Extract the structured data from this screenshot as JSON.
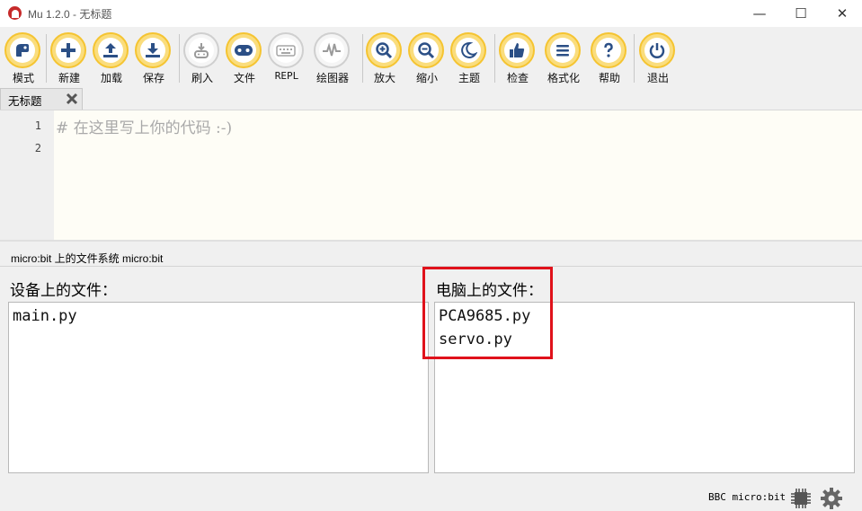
{
  "window": {
    "title": "Mu 1.2.0 - 无标题",
    "minimize_glyph": "—",
    "maximize_glyph": "☐",
    "close_glyph": "✕"
  },
  "toolbar": {
    "buttons": [
      {
        "label": "模式",
        "icon": "mode-icon",
        "enabled": true
      },
      {
        "label": "新建",
        "icon": "plus-icon",
        "enabled": true
      },
      {
        "label": "加载",
        "icon": "upload-icon",
        "enabled": true
      },
      {
        "label": "保存",
        "icon": "download-icon",
        "enabled": true
      },
      {
        "label": "刷入",
        "icon": "flash-icon",
        "enabled": false
      },
      {
        "label": "文件",
        "icon": "microbit-icon",
        "enabled": true
      },
      {
        "label": "REPL",
        "icon": "keyboard-icon",
        "enabled": false
      },
      {
        "label": "绘图器",
        "icon": "plotter-icon",
        "enabled": false
      },
      {
        "label": "放大",
        "icon": "zoom-in-icon",
        "enabled": true
      },
      {
        "label": "缩小",
        "icon": "zoom-out-icon",
        "enabled": true
      },
      {
        "label": "主题",
        "icon": "moon-icon",
        "enabled": true
      },
      {
        "label": "检查",
        "icon": "thumbs-up-icon",
        "enabled": true
      },
      {
        "label": "格式化",
        "icon": "format-lines-icon",
        "enabled": true
      },
      {
        "label": "帮助",
        "icon": "question-icon",
        "enabled": true
      },
      {
        "label": "退出",
        "icon": "power-icon",
        "enabled": true
      }
    ]
  },
  "tabs": [
    {
      "label": "无标题",
      "active": true
    }
  ],
  "editor": {
    "line_numbers": [
      "1",
      "2"
    ],
    "lines": [
      "# 在这里写上你的代码 :-)",
      ""
    ]
  },
  "files_pane": {
    "title": "micro:bit 上的文件系统 micro:bit",
    "device_header": "设备上的文件：",
    "computer_header": "电脑上的文件：",
    "device_files": [
      "main.py"
    ],
    "computer_files": [
      "PCA9685.py",
      "servo.py"
    ]
  },
  "statusbar": {
    "mode": "BBC micro:bit"
  },
  "colors": {
    "button_fill": "#fadd7d",
    "button_border": "#f5c431",
    "icon_blue": "#2b4f86",
    "highlight_red": "#e0121b",
    "editor_bg": "#fefdf6"
  }
}
